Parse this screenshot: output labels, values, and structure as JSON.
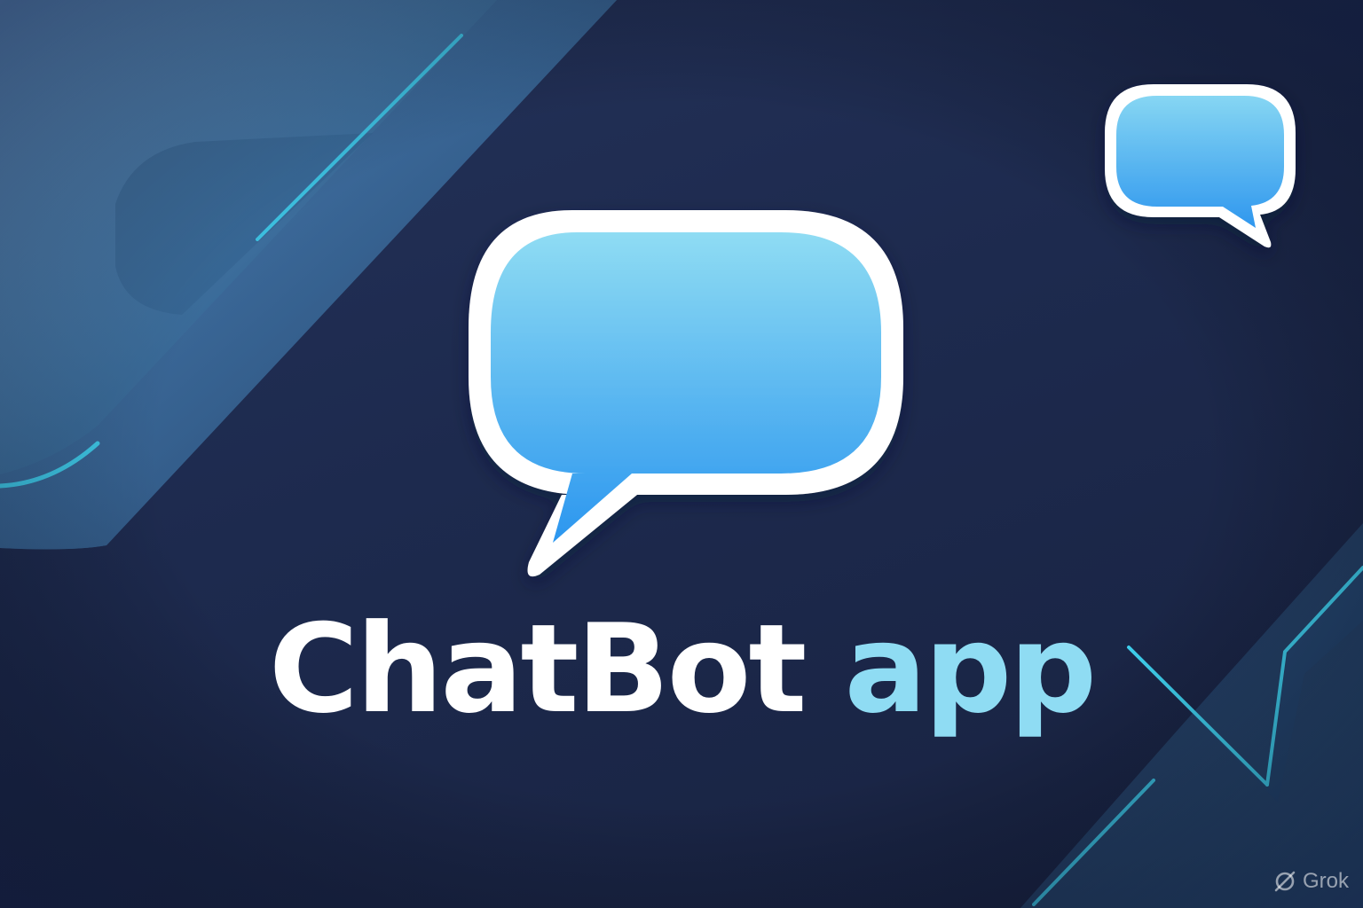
{
  "title": {
    "main": "ChatBot",
    "accent": "app"
  },
  "watermark": {
    "text": "Grok",
    "icon": "grok-logo-icon"
  },
  "colors": {
    "background": "#1d2a4e",
    "bubble_fill_top": "#8fdcf3",
    "bubble_fill_bottom": "#2b96ef",
    "bubble_outline": "#ffffff",
    "title_main": "#ffffff",
    "title_accent": "#8fdcf3",
    "glow_line": "#3fd0ee"
  },
  "icons": {
    "main": "chat-bubble-icon",
    "small": "small-chat-bubble-icon"
  }
}
